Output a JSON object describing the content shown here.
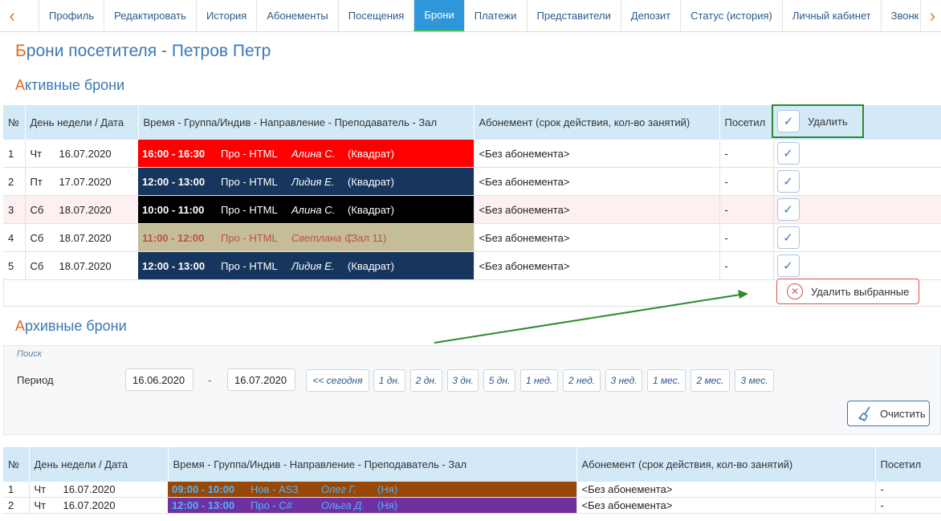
{
  "tabs": [
    {
      "label": "Профиль",
      "active": false
    },
    {
      "label": "Редактировать",
      "active": false
    },
    {
      "label": "История",
      "active": false
    },
    {
      "label": "Абонементы",
      "active": false
    },
    {
      "label": "Посещения",
      "active": false
    },
    {
      "label": "Брони",
      "active": true
    },
    {
      "label": "Платежи",
      "active": false
    },
    {
      "label": "Представители",
      "active": false
    },
    {
      "label": "Депозит",
      "active": false
    },
    {
      "label": "Статус (история)",
      "active": false
    },
    {
      "label": "Личный кабинет",
      "active": false
    },
    {
      "label": "Звонк",
      "active": false
    }
  ],
  "page_title": {
    "first": "Б",
    "rest": "рони посетителя - Петров Петр"
  },
  "active_section": {
    "title_first": "А",
    "title_rest": "ктивные брони",
    "columns": {
      "num": "№",
      "date": "День недели / Дата",
      "slot": "Время - Группа/Индив - Направление - Преподаватель - Зал",
      "subscription": "Абонемент (срок действия, кол-во занятий)",
      "visited": "Посетил",
      "delete": "Удалить"
    },
    "rows": [
      {
        "num": "1",
        "day": "Чт",
        "date": "16.07.2020",
        "time": "16:00 - 16:30",
        "group": "Про - HTML",
        "teacher": "Алина С.",
        "room": "(Квадрат)",
        "bg": "#ff0000",
        "fg": "#ffffff",
        "subscription": "<Без абонемента>",
        "visited": "-",
        "pink": false
      },
      {
        "num": "2",
        "day": "Пт",
        "date": "17.07.2020",
        "time": "12:00 - 13:00",
        "group": "Про - HTML",
        "teacher": "Лидия Е.",
        "room": "(Квадрат)",
        "bg": "#17365d",
        "fg": "#ffffff",
        "subscription": "<Без абонемента>",
        "visited": "-",
        "pink": false
      },
      {
        "num": "3",
        "day": "Сб",
        "date": "18.07.2020",
        "time": "10:00 - 11:00",
        "group": "Про - HTML",
        "teacher": "Алина С.",
        "room": "(Квадрат)",
        "bg": "#000000",
        "fg": "#ffffff",
        "subscription": "<Без абонемента>",
        "visited": "-",
        "pink": true
      },
      {
        "num": "4",
        "day": "Сб",
        "date": "18.07.2020",
        "time": "11:00 - 12:00",
        "group": "Про - HTML",
        "teacher": "Светлана С.",
        "room": "(Зал 11)",
        "bg": "#c4bd97",
        "fg": "#c0504d",
        "subscription": "<Без абонемента>",
        "visited": "-",
        "pink": false
      },
      {
        "num": "5",
        "day": "Сб",
        "date": "18.07.2020",
        "time": "12:00 - 13:00",
        "group": "Про - HTML",
        "teacher": "Лидия Е.",
        "room": "(Квадрат)",
        "bg": "#17365d",
        "fg": "#ffffff",
        "subscription": "<Без абонемента>",
        "visited": "-",
        "pink": false
      }
    ],
    "delete_selected_label": "Удалить выбранные"
  },
  "archive_section": {
    "title_first": "А",
    "title_rest": "рхивные брони",
    "search": {
      "label": "Поиск",
      "period_label": "Период",
      "date_from": "16.06.2020",
      "dash": "-",
      "date_to": "16.07.2020",
      "quick_buttons": [
        "<< сегодня",
        "1 дн.",
        "2 дн.",
        "3 дн.",
        "5 дн.",
        "1 нед.",
        "2 нед.",
        "3 нед.",
        "1 мес.",
        "2 мес.",
        "3 мес."
      ],
      "clear_label": "Очистить"
    },
    "columns": {
      "num": "№",
      "date": "День недели / Дата",
      "slot": "Время - Группа/Индив - Направление - Преподаватель - Зал",
      "subscription": "Абонемент (срок действия, кол-во занятий)",
      "visited": "Посетил"
    },
    "rows": [
      {
        "num": "1",
        "day": "Чт",
        "date": "16.07.2020",
        "time": "09:00 - 10:00",
        "group": "Нов - AS3",
        "teacher": "Олег Г.",
        "room": "(Ня)",
        "bg": "#974806",
        "fg": "#4fb3ff",
        "subscription": "<Без абонемента>",
        "visited": "-"
      },
      {
        "num": "2",
        "day": "Чт",
        "date": "16.07.2020",
        "time": "12:00 - 13:00",
        "group": "Про - C#",
        "teacher": "Ольга Д.",
        "room": "(Ня)",
        "bg": "#7030a0",
        "fg": "#4fb3ff",
        "subscription": "<Без абонемента>",
        "visited": "-"
      }
    ]
  },
  "colors": {
    "accent": "#2f97d9",
    "title": "#3a78b5",
    "title_first_letter": "#e8641e",
    "annotation_green": "#2d8a2d"
  }
}
